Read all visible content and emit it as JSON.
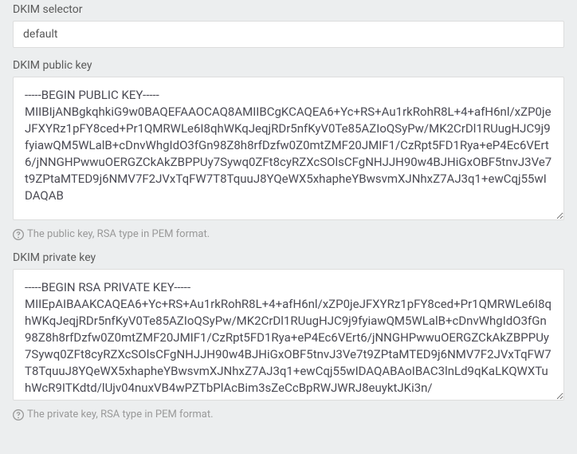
{
  "selector": {
    "label": "DKIM selector",
    "value": "default"
  },
  "public_key": {
    "label": "DKIM public key",
    "value": "-----BEGIN PUBLIC KEY-----\nMIIBIjANBgkqhkiG9w0BAQEFAAOCAQ8AMIIBCgKCAQEA6+Yc+RS+Au1rkRohR8L+4+afH6nl/xZP0jeJFXYRz1pFY8ced+Pr1QMRWLe6I8qhWKqJeqjRDr5nfKyV0Te85AZIoQSyPw/MK2CrDl1RUugHJC9j9fyiawQM5WLalB+cDnvWhgIdO3fGn98Z8h8rfDzfw0Z0mtZMF20JMIF1/CzRpt5FD1Rya+eP4Ec6VErt6/jNNGHPwwuOERGZCkAkZBPPUy7Sywq0ZFt8cyRZXcSOlsCFgNHJJH90w4BJHiGxOBF5tnvJ3Ve7t9ZPtaMTED9j6NMV7F2JVxTqFW7T8TquuJ8YQeWX5xhapheYBwsvmXJNhxZ7AJ3q1+ewCqj55wIDAQAB",
    "helper": "The public key, RSA type in PEM format."
  },
  "private_key": {
    "label": "DKIM private key",
    "value": "-----BEGIN RSA PRIVATE KEY-----\nMIIEpAIBAAKCAQEA6+Yc+RS+Au1rkRohR8L+4+afH6nl/xZP0jeJFXYRz1pFY8ced+Pr1QMRWLe6I8qhWKqJeqjRDr5nfKyV0Te85AZIoQSyPw/MK2CrDl1RUugHJC9j9fyiawQM5WLalB+cDnvWhgIdO3fGn98Z8h8rfDzfw0Z0mtZMF20JMIF1/CzRpt5FD1Rya+eP4Ec6VErt6/jNNGHPwwuOERGZCkAkZBPPUy7Sywq0ZFt8cyRZXcSOlsCFgNHJJH90w4BJHiGxOBF5tnvJ3Ve7t9ZPtaMTED9j6NMV7F2JVxTqFW7T8TquuJ8YQeWX5xhapheYBwsvmXJNhxZ7AJ3q1+ewCqj55wIDAQABAoIBAC3lnLd9qKaLKQWXTuhWcR9ITKdtd/lUjv04nuxVB4wPZTbPlAcBim3sZeCcBpRWJWRJ8euyktJKi3n/",
    "helper": "The private key, RSA type in PEM format."
  }
}
